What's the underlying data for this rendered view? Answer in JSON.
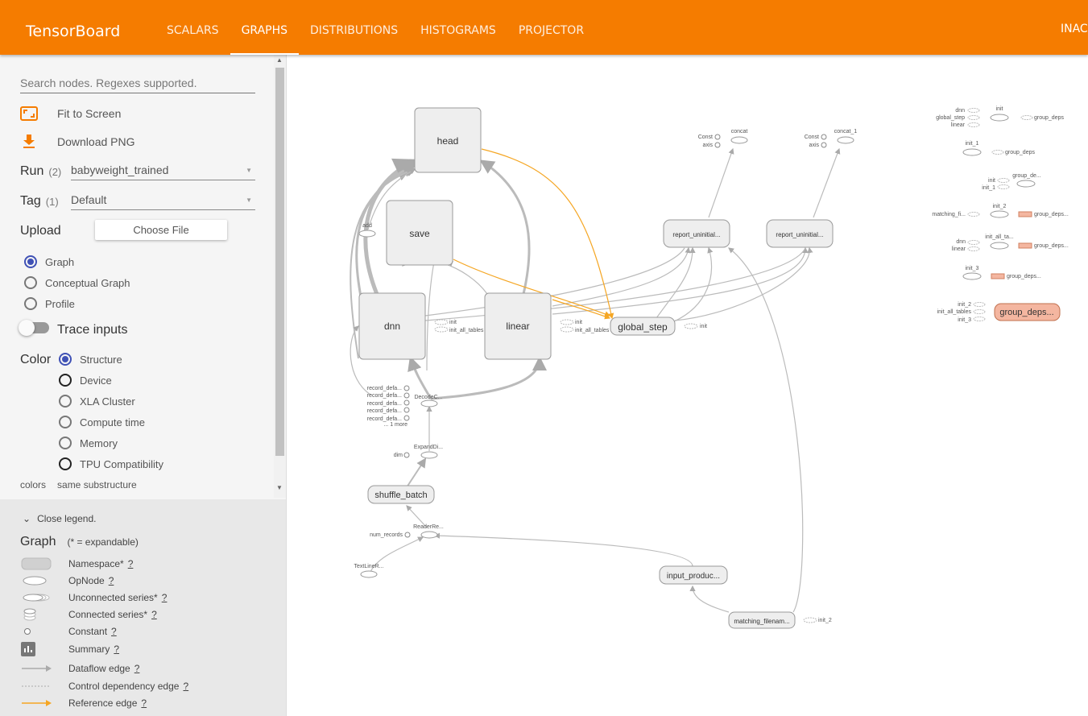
{
  "brand": "TensorBoard",
  "tabs": [
    "SCALARS",
    "GRAPHS",
    "DISTRIBUTIONS",
    "HISTOGRAMS",
    "PROJECTOR"
  ],
  "tab_overflow": "INAC",
  "colors": {
    "accent": "#f57c00",
    "radio_on": "#3f51b5",
    "namespace_fill": "#e8e8e8",
    "highlight_fill": "#f4b6a0"
  },
  "sidebar": {
    "search_placeholder": "Search nodes. Regexes supported.",
    "fit_label": "Fit to Screen",
    "download_label": "Download PNG",
    "run_label": "Run",
    "run_count": "(2)",
    "run_value": "babyweight_trained",
    "tag_label": "Tag",
    "tag_count": "(1)",
    "tag_value": "Default",
    "upload_label": "Upload",
    "choose_file": "Choose File",
    "graph_modes": [
      "Graph",
      "Conceptual Graph",
      "Profile"
    ],
    "trace_label": "Trace inputs",
    "color_label": "Color",
    "color_options": [
      "Structure",
      "Device",
      "XLA Cluster",
      "Compute time",
      "Memory",
      "TPU Compatibility"
    ],
    "colors_label": "colors",
    "colors_value": "same substructure"
  },
  "legend": {
    "close": "Close legend.",
    "graph_label": "Graph",
    "expandable_note": "(* = expandable)",
    "items": [
      "Namespace*",
      "OpNode",
      "Unconnected series*",
      "Connected series*",
      "Constant",
      "Summary",
      "Dataflow edge",
      "Control dependency edge",
      "Reference edge"
    ],
    "q": "?"
  },
  "graph": {
    "head": "head",
    "save": "save",
    "dnn": "dnn",
    "linear": "linear",
    "global_step": "global_step",
    "shuffle_batch": "shuffle_batch",
    "input_producer": "input_produc...",
    "matching_filenames": "matching_filenam...",
    "report1": "report_uninitial...",
    "report2": "report_uninitial...",
    "add": "add",
    "decode": "DecodeC...",
    "expand": "ExpandDi...",
    "dim": "dim",
    "reader": "ReaderRe...",
    "num_records": "num_records",
    "textline": "TextLineR...",
    "record_defaults": [
      "record_defa...",
      "record_defa...",
      "record_defa...",
      "record_defa...",
      "record_defa..."
    ],
    "one_more": "... 1 more",
    "init": "init",
    "init_all_tables": "init_all_tables",
    "init_2": "init_2",
    "concat": "concat",
    "concat_1": "concat_1",
    "const": "Const",
    "axis": "axis",
    "aux": {
      "init": "init",
      "dnn": "dnn",
      "global_step": "global_step",
      "linear": "linear",
      "group_deps": "group_deps",
      "init_1": "init_1",
      "group_de": "group_de...",
      "init_2": "init_2",
      "matching_fi": "matching_fi...",
      "group_deps_t": "group_deps...",
      "init_all_ta": "init_all_ta...",
      "init_3": "init_3",
      "init_all_tables": "init_all_tables",
      "group_deps_big": "group_deps..."
    }
  }
}
